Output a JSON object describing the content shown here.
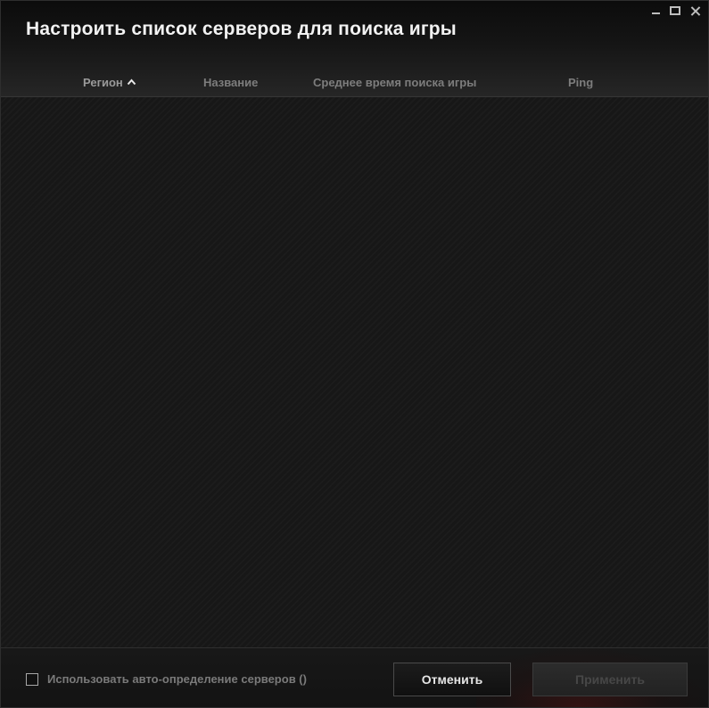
{
  "window": {
    "title": "Настроить список серверов для поиска игры"
  },
  "columns": {
    "region": "Регион",
    "name": "Название",
    "avg_search_time": "Среднее время поиска игры",
    "ping": "Ping"
  },
  "servers": [],
  "footer": {
    "auto_detect_label": "Использовать авто-определение серверов ()",
    "auto_detect_checked": false,
    "cancel_label": "Отменить",
    "apply_label": "Применить"
  },
  "icons": {
    "sort": "chevron-up-icon",
    "minimize": "minimize-icon",
    "maximize": "maximize-icon",
    "close": "close-icon"
  },
  "colors": {
    "background": "#171717",
    "title_text": "#f2f2f2",
    "column_text": "#7d7d7d",
    "apply_disabled_text": "#474747"
  }
}
